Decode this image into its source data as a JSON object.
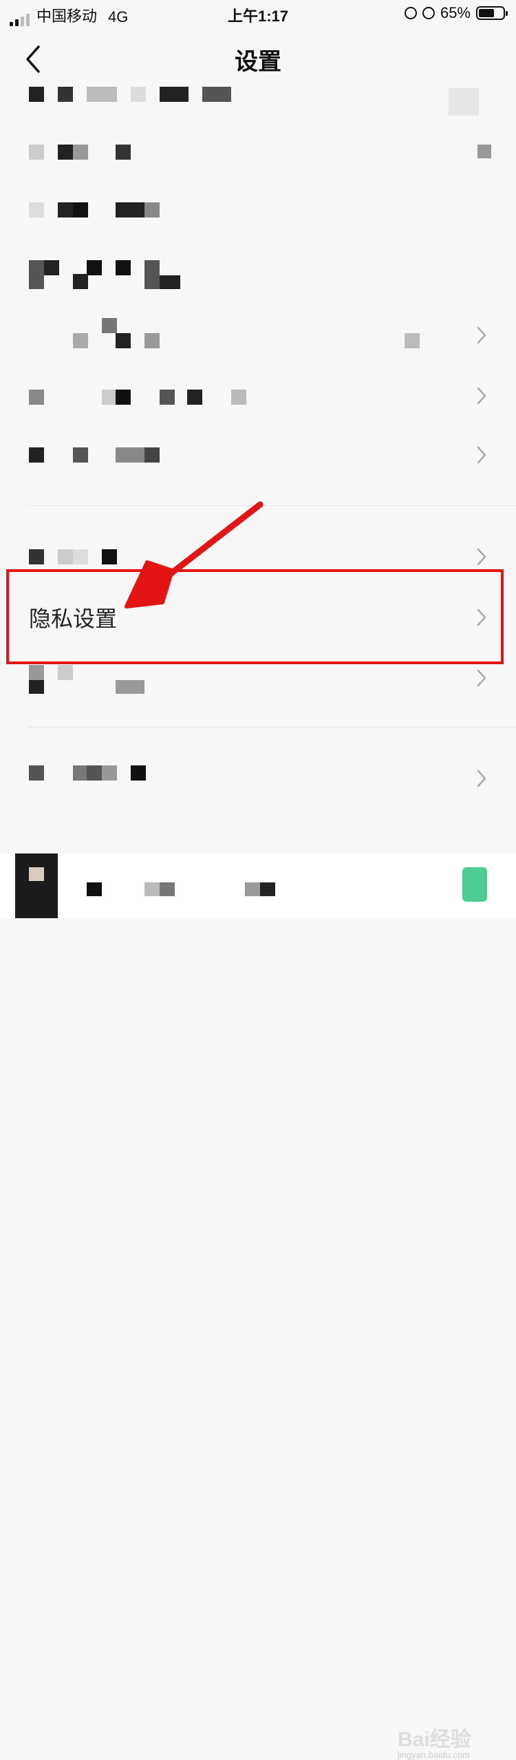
{
  "status_bar": {
    "carrier": "中国移动",
    "network": "4G",
    "time": "上午1:17",
    "battery_percent": "65%",
    "battery_level": 0.65
  },
  "navbar": {
    "back_icon": "chevron-left-icon",
    "title": "设置"
  },
  "settings_list": {
    "privacy_label": "隐私设置",
    "row_chevron_icon": "chevron-right-icon"
  },
  "annotation": {
    "highlight_color": "#e41414",
    "arrow_color": "#e41414"
  },
  "watermark": {
    "text": "Bai经验",
    "url_text": "jingyan.baidu.com"
  }
}
